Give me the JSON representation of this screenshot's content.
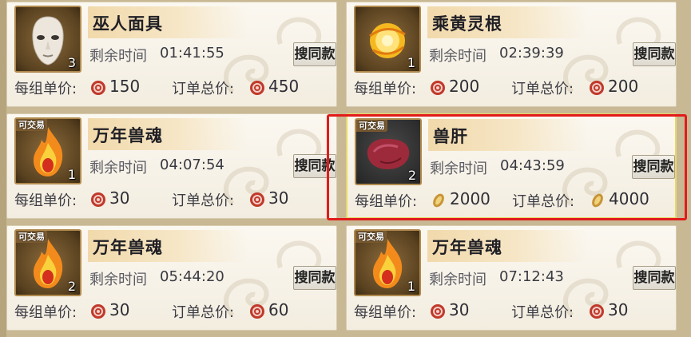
{
  "labels": {
    "time_remaining": "剩余时间",
    "unit_price": "每组单价:",
    "total_price": "订单总价:",
    "search_same": "搜同款",
    "tradable": "可交易"
  },
  "colors": {
    "highlight": "#e21b1b",
    "selected_border": "#e7d86a",
    "currency_coin": "#c0392b",
    "currency_gold": "#c89436"
  },
  "listings": [
    {
      "name": "巫人面具",
      "quantity": "3",
      "time": "01:41:55",
      "unit_price": "150",
      "total_price": "450",
      "currency_icon": "red-coin-icon",
      "item_icon": "mask-icon",
      "tradable": false
    },
    {
      "name": "乘黄灵根",
      "quantity": "1",
      "time": "02:39:39",
      "unit_price": "200",
      "total_price": "200",
      "currency_icon": "red-coin-icon",
      "item_icon": "golden-orb-icon",
      "tradable": false
    },
    {
      "name": "万年兽魂",
      "quantity": "1",
      "time": "04:07:54",
      "unit_price": "30",
      "total_price": "30",
      "currency_icon": "red-coin-icon",
      "item_icon": "flame-soul-icon",
      "tradable": true
    },
    {
      "name": "兽肝",
      "quantity": "2",
      "time": "04:43:59",
      "unit_price": "2000",
      "total_price": "4000",
      "currency_icon": "gold-ingot-icon",
      "item_icon": "liver-icon",
      "tradable": true
    },
    {
      "name": "万年兽魂",
      "quantity": "2",
      "time": "05:44:20",
      "unit_price": "30",
      "total_price": "60",
      "currency_icon": "red-coin-icon",
      "item_icon": "flame-soul-icon",
      "tradable": true
    },
    {
      "name": "万年兽魂",
      "quantity": "1",
      "time": "07:12:43",
      "unit_price": "30",
      "total_price": "30",
      "currency_icon": "red-coin-icon",
      "item_icon": "flame-soul-icon",
      "tradable": true
    }
  ]
}
